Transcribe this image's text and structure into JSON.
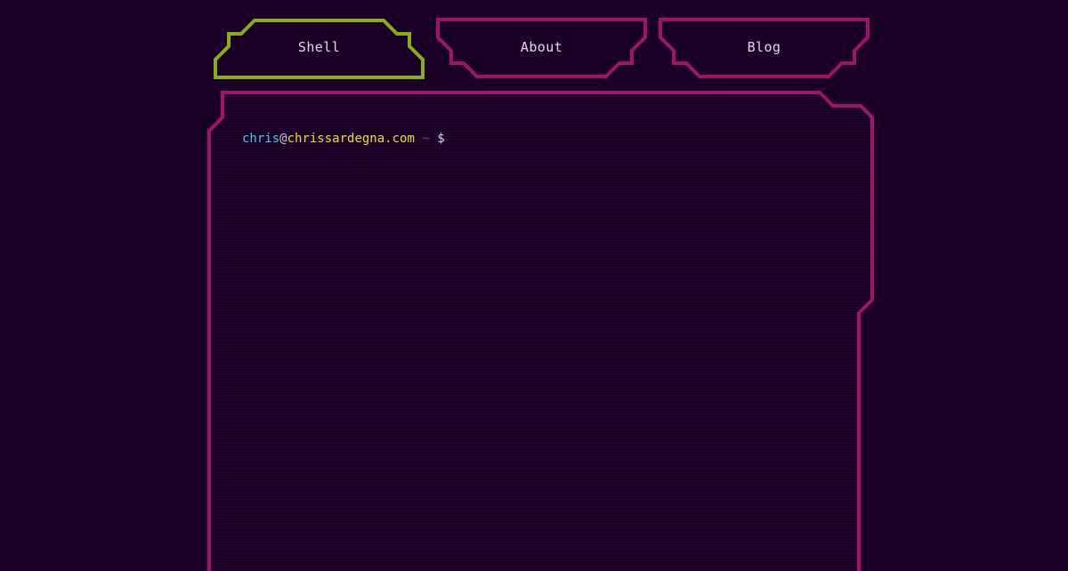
{
  "tabs": [
    {
      "label": "Shell",
      "active": true
    },
    {
      "label": "About",
      "active": false
    },
    {
      "label": "Blog",
      "active": false
    }
  ],
  "terminal": {
    "prompt": {
      "user": "chris",
      "at": "@",
      "host": "chrissardegna.com",
      "path": "~",
      "symbol": "$"
    }
  },
  "colors": {
    "background": "#1a0026",
    "active_tab": "#8aae12",
    "border": "#a0136a",
    "user": "#46c8e0",
    "at": "#d0c8d0",
    "host": "#f0dc30",
    "tilde": "#c8186e",
    "dollar": "#e0d0e0"
  }
}
